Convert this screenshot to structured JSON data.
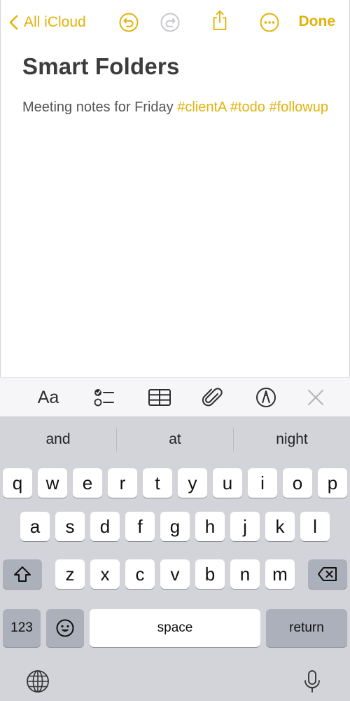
{
  "nav": {
    "back_label": "All iCloud",
    "done_label": "Done"
  },
  "colors": {
    "accent": "#e3b209",
    "title_text": "#3c3c3c",
    "body_text": "#555555",
    "keyboard_bg": "#d2d4da"
  },
  "note": {
    "title": "Smart Folders",
    "body_text": "Meeting notes for Friday",
    "tags": [
      "#clientA",
      "#todo",
      "#followup"
    ]
  },
  "toolbar": {
    "format_label": "Aa",
    "icons": [
      "checklist-icon",
      "table-icon",
      "paperclip-icon",
      "markup-icon",
      "close-icon"
    ]
  },
  "keyboard": {
    "suggestions": [
      "and",
      "at",
      "night"
    ],
    "row1": [
      "q",
      "w",
      "e",
      "r",
      "t",
      "y",
      "u",
      "i",
      "o",
      "p"
    ],
    "row2": [
      "a",
      "s",
      "d",
      "f",
      "g",
      "h",
      "j",
      "k",
      "l"
    ],
    "row3": [
      "z",
      "x",
      "c",
      "v",
      "b",
      "n",
      "m"
    ],
    "numbers_label": "123",
    "space_label": "space",
    "return_label": "return"
  }
}
